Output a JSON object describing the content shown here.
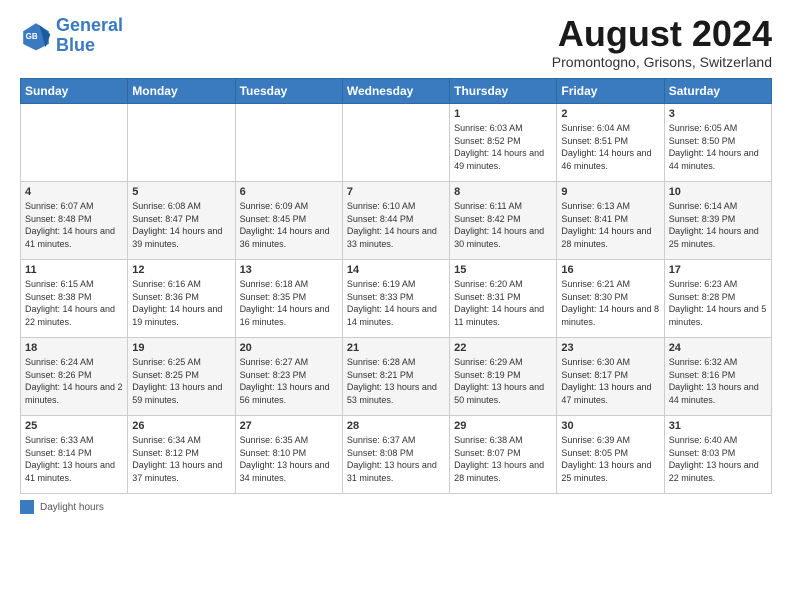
{
  "header": {
    "logo_line1": "General",
    "logo_line2": "Blue",
    "month_title": "August 2024",
    "location": "Promontogno, Grisons, Switzerland"
  },
  "days_of_week": [
    "Sunday",
    "Monday",
    "Tuesday",
    "Wednesday",
    "Thursday",
    "Friday",
    "Saturday"
  ],
  "legend_label": "Daylight hours",
  "weeks": [
    {
      "days": [
        {
          "num": "",
          "text": ""
        },
        {
          "num": "",
          "text": ""
        },
        {
          "num": "",
          "text": ""
        },
        {
          "num": "",
          "text": ""
        },
        {
          "num": "1",
          "text": "Sunrise: 6:03 AM\nSunset: 8:52 PM\nDaylight: 14 hours and 49 minutes."
        },
        {
          "num": "2",
          "text": "Sunrise: 6:04 AM\nSunset: 8:51 PM\nDaylight: 14 hours and 46 minutes."
        },
        {
          "num": "3",
          "text": "Sunrise: 6:05 AM\nSunset: 8:50 PM\nDaylight: 14 hours and 44 minutes."
        }
      ]
    },
    {
      "days": [
        {
          "num": "4",
          "text": "Sunrise: 6:07 AM\nSunset: 8:48 PM\nDaylight: 14 hours and 41 minutes."
        },
        {
          "num": "5",
          "text": "Sunrise: 6:08 AM\nSunset: 8:47 PM\nDaylight: 14 hours and 39 minutes."
        },
        {
          "num": "6",
          "text": "Sunrise: 6:09 AM\nSunset: 8:45 PM\nDaylight: 14 hours and 36 minutes."
        },
        {
          "num": "7",
          "text": "Sunrise: 6:10 AM\nSunset: 8:44 PM\nDaylight: 14 hours and 33 minutes."
        },
        {
          "num": "8",
          "text": "Sunrise: 6:11 AM\nSunset: 8:42 PM\nDaylight: 14 hours and 30 minutes."
        },
        {
          "num": "9",
          "text": "Sunrise: 6:13 AM\nSunset: 8:41 PM\nDaylight: 14 hours and 28 minutes."
        },
        {
          "num": "10",
          "text": "Sunrise: 6:14 AM\nSunset: 8:39 PM\nDaylight: 14 hours and 25 minutes."
        }
      ]
    },
    {
      "days": [
        {
          "num": "11",
          "text": "Sunrise: 6:15 AM\nSunset: 8:38 PM\nDaylight: 14 hours and 22 minutes."
        },
        {
          "num": "12",
          "text": "Sunrise: 6:16 AM\nSunset: 8:36 PM\nDaylight: 14 hours and 19 minutes."
        },
        {
          "num": "13",
          "text": "Sunrise: 6:18 AM\nSunset: 8:35 PM\nDaylight: 14 hours and 16 minutes."
        },
        {
          "num": "14",
          "text": "Sunrise: 6:19 AM\nSunset: 8:33 PM\nDaylight: 14 hours and 14 minutes."
        },
        {
          "num": "15",
          "text": "Sunrise: 6:20 AM\nSunset: 8:31 PM\nDaylight: 14 hours and 11 minutes."
        },
        {
          "num": "16",
          "text": "Sunrise: 6:21 AM\nSunset: 8:30 PM\nDaylight: 14 hours and 8 minutes."
        },
        {
          "num": "17",
          "text": "Sunrise: 6:23 AM\nSunset: 8:28 PM\nDaylight: 14 hours and 5 minutes."
        }
      ]
    },
    {
      "days": [
        {
          "num": "18",
          "text": "Sunrise: 6:24 AM\nSunset: 8:26 PM\nDaylight: 14 hours and 2 minutes."
        },
        {
          "num": "19",
          "text": "Sunrise: 6:25 AM\nSunset: 8:25 PM\nDaylight: 13 hours and 59 minutes."
        },
        {
          "num": "20",
          "text": "Sunrise: 6:27 AM\nSunset: 8:23 PM\nDaylight: 13 hours and 56 minutes."
        },
        {
          "num": "21",
          "text": "Sunrise: 6:28 AM\nSunset: 8:21 PM\nDaylight: 13 hours and 53 minutes."
        },
        {
          "num": "22",
          "text": "Sunrise: 6:29 AM\nSunset: 8:19 PM\nDaylight: 13 hours and 50 minutes."
        },
        {
          "num": "23",
          "text": "Sunrise: 6:30 AM\nSunset: 8:17 PM\nDaylight: 13 hours and 47 minutes."
        },
        {
          "num": "24",
          "text": "Sunrise: 6:32 AM\nSunset: 8:16 PM\nDaylight: 13 hours and 44 minutes."
        }
      ]
    },
    {
      "days": [
        {
          "num": "25",
          "text": "Sunrise: 6:33 AM\nSunset: 8:14 PM\nDaylight: 13 hours and 41 minutes."
        },
        {
          "num": "26",
          "text": "Sunrise: 6:34 AM\nSunset: 8:12 PM\nDaylight: 13 hours and 37 minutes."
        },
        {
          "num": "27",
          "text": "Sunrise: 6:35 AM\nSunset: 8:10 PM\nDaylight: 13 hours and 34 minutes."
        },
        {
          "num": "28",
          "text": "Sunrise: 6:37 AM\nSunset: 8:08 PM\nDaylight: 13 hours and 31 minutes."
        },
        {
          "num": "29",
          "text": "Sunrise: 6:38 AM\nSunset: 8:07 PM\nDaylight: 13 hours and 28 minutes."
        },
        {
          "num": "30",
          "text": "Sunrise: 6:39 AM\nSunset: 8:05 PM\nDaylight: 13 hours and 25 minutes."
        },
        {
          "num": "31",
          "text": "Sunrise: 6:40 AM\nSunset: 8:03 PM\nDaylight: 13 hours and 22 minutes."
        }
      ]
    }
  ]
}
